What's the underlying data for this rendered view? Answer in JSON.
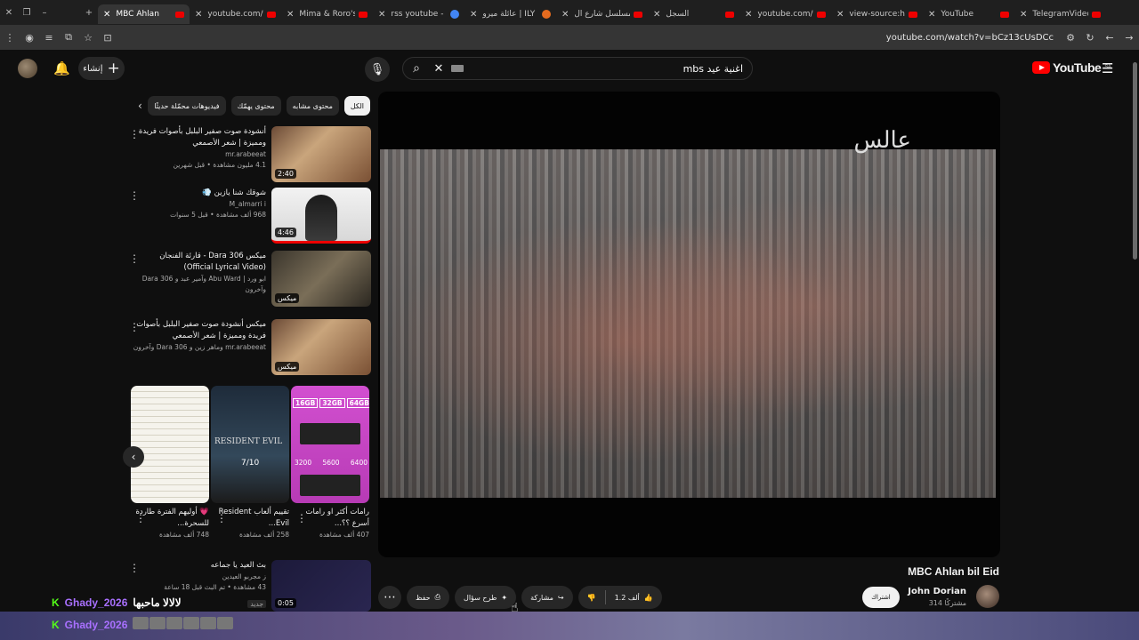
{
  "browser": {
    "tabs": [
      {
        "title": "MBC Ahlan",
        "favicon": "youtube",
        "active": true
      },
      {
        "title": "youtube.com/f",
        "favicon": "youtube"
      },
      {
        "title": "Mima & Roro's",
        "favicon": "youtube"
      },
      {
        "title": "rss youtube - ",
        "favicon": "google"
      },
      {
        "title": "عائلة ميرو | ILY",
        "favicon": "orange"
      },
      {
        "title": "مسلسل شارع ال",
        "favicon": "youtube"
      },
      {
        "title": "السجل",
        "favicon": "history"
      },
      {
        "title": "youtube.com/f",
        "favicon": "youtube"
      },
      {
        "title": "view-source:ht",
        "favicon": "youtube"
      },
      {
        "title": "YouTube",
        "favicon": "youtube"
      },
      {
        "title": "TelegramVideo",
        "favicon": "youtube"
      }
    ],
    "url": "youtube.com/watch?v=bCz13cUsDCc"
  },
  "header": {
    "create_label": "إنشاء",
    "search_value": "اغنية عيد mbs",
    "logo_text": "YouTube",
    "logo_region": "SA"
  },
  "chips": [
    {
      "label": "الكل",
      "active": true
    },
    {
      "label": "محتوى مشابه"
    },
    {
      "label": "محتوى يهمّك"
    },
    {
      "label": "فيديوهات محمّلة حديثًا"
    }
  ],
  "related": [
    {
      "title": "أنشودة صوت صفير البلبل بأصوات فريدة ومميزة | شعر الأصمعي",
      "channel": "mr.arabeeat",
      "stats": "4.1 مليون مشاهدة • قبل شهرين",
      "duration": "2:40"
    },
    {
      "title": "شوقك شنا يازين 💨",
      "channel": "M_almarri i",
      "stats": "968 ألف مشاهدة • قبل 5 سنوات",
      "duration": "4:46"
    },
    {
      "title": "ميكس Dara 306 - قارئة الفنجان (Official Lyrical Video)",
      "channel": "ابو ورد | Abu Ward وآمير عبد و Dara 306 وآخرون",
      "stats": "",
      "duration": "ميكس"
    },
    {
      "title": "ميكس أنشودة صوت صفير البلبل بأصوات فريدة ومميزة | شعر الأصمعي",
      "channel": "mr.arabeeat وماهر زين و Dara 306 وآخرون",
      "stats": "",
      "duration": "ميكس"
    }
  ],
  "shorts": [
    {
      "title": "رامات أكثر او رامات أسرع ؟؟...",
      "views": "407 ألف مشاهدة",
      "chips": [
        "16GB",
        "32GB",
        "64GB"
      ],
      "speeds": [
        "3200",
        "5600",
        "6400"
      ]
    },
    {
      "title": "تقييم ألعاب Resident Evil...",
      "views": "258 ألف مشاهدة",
      "game": "RESIDENT EVIL",
      "score": "7/10"
    },
    {
      "title": "💗 أوليهم الفترة طاردة للسحرة...",
      "views": "748 ألف مشاهدة"
    }
  ],
  "bottom_related": {
    "title": "بث العيد يا جماعه",
    "channel": "ز مجربو العيدين",
    "stats": "43 مشاهدة • تم البث قبل 18 ساعة",
    "badge": "جديد",
    "duration": "0:05"
  },
  "player": {
    "brand": "عالس"
  },
  "video": {
    "title": "MBC Ahlan bil Eid",
    "channel": "John Dorian",
    "subscribers": "314 مشتركًا",
    "subscribe_label": "اشتراك",
    "likes": "1.2 ألف",
    "share_label": "مشاركة",
    "ask_label": "طرح سؤال",
    "save_label": "حفظ"
  },
  "chat": [
    {
      "user": "Ghady_2026",
      "message": "لالالا ماحبها"
    },
    {
      "user": "Ghady_2026",
      "message": ""
    }
  ]
}
